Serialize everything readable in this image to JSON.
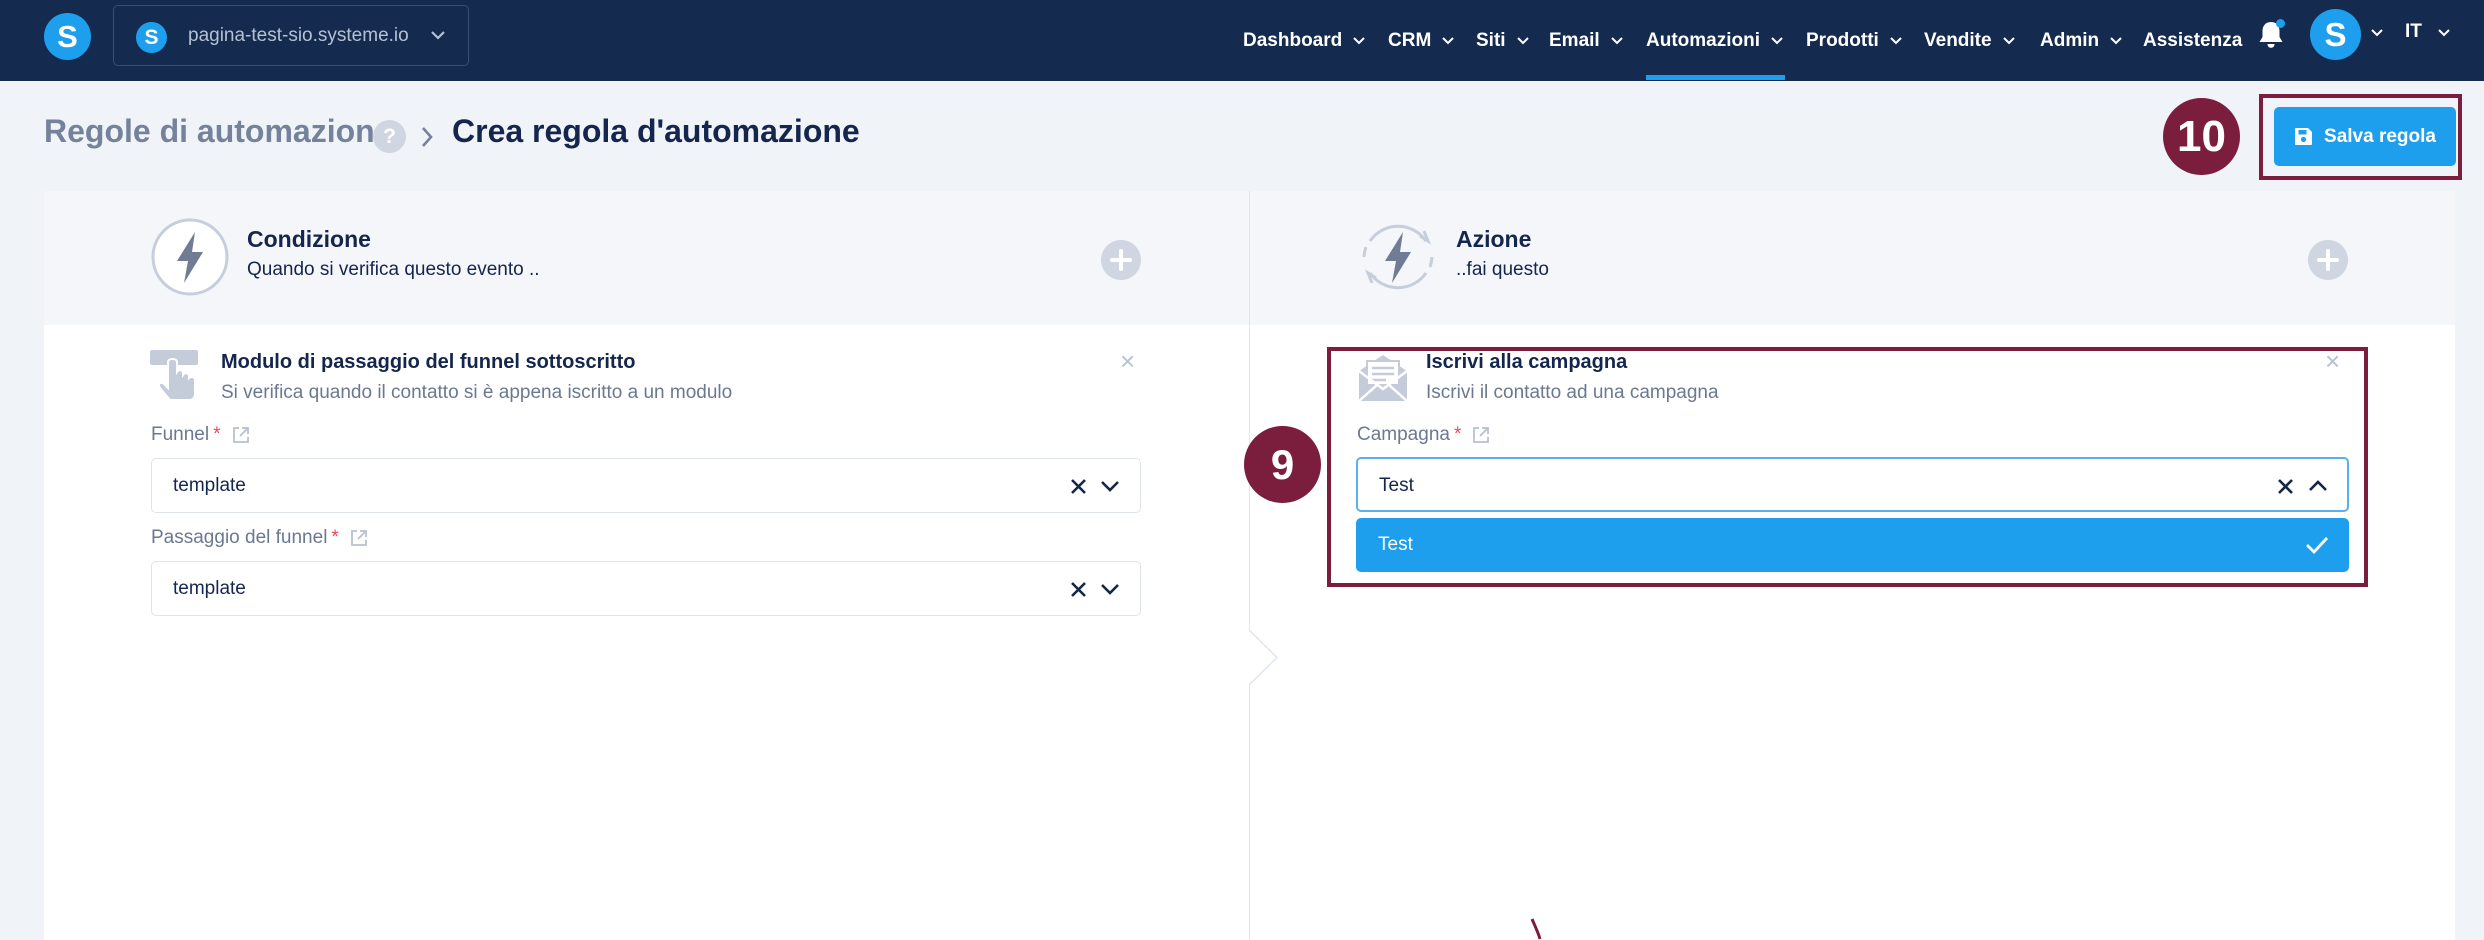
{
  "app": {
    "logo_letter": "S"
  },
  "site": {
    "name": "pagina-test-sio.systeme.io",
    "logo_letter": "S"
  },
  "nav": {
    "items": [
      {
        "label": "Dashboard",
        "has_dropdown": true
      },
      {
        "label": "CRM",
        "has_dropdown": true
      },
      {
        "label": "Siti",
        "has_dropdown": true
      },
      {
        "label": "Email",
        "has_dropdown": true
      },
      {
        "label": "Automazioni",
        "has_dropdown": true,
        "active": true
      },
      {
        "label": "Prodotti",
        "has_dropdown": true
      },
      {
        "label": "Vendite",
        "has_dropdown": true
      },
      {
        "label": "Admin",
        "has_dropdown": true
      },
      {
        "label": "Assistenza",
        "has_dropdown": false
      }
    ],
    "user_avatar_letter": "S",
    "language": "IT"
  },
  "breadcrumb": {
    "root": "Regole di automazione",
    "help": "?",
    "current": "Crea regola d'automazione"
  },
  "toolbar": {
    "save_label": "Salva regola"
  },
  "annotations": {
    "badge_save": "10",
    "badge_action": "9"
  },
  "condition": {
    "title": "Condizione",
    "subtitle": "Quando si verifica questo evento ..",
    "card": {
      "title": "Modulo di passaggio del funnel sottoscritto",
      "subtitle": "Si verifica quando il contatto si è appena iscritto a un modulo",
      "close": "×"
    },
    "funnel": {
      "label": "Funnel",
      "required": "*",
      "value": "template"
    },
    "step": {
      "label": "Passaggio del funnel",
      "required": "*",
      "value": "template"
    }
  },
  "action": {
    "title": "Azione",
    "subtitle": "..fai questo",
    "card": {
      "title": "Iscrivi alla campagna",
      "subtitle": "Iscrivi il contatto ad una campagna",
      "close": "×"
    },
    "campaign": {
      "label": "Campagna",
      "required": "*",
      "value": "Test",
      "options": [
        "Test"
      ]
    }
  },
  "colors": {
    "nav_bg": "#142a4f",
    "accent": "#1e9fee",
    "annotation": "#7b1d3c",
    "page_bg": "#f0f3f8"
  }
}
